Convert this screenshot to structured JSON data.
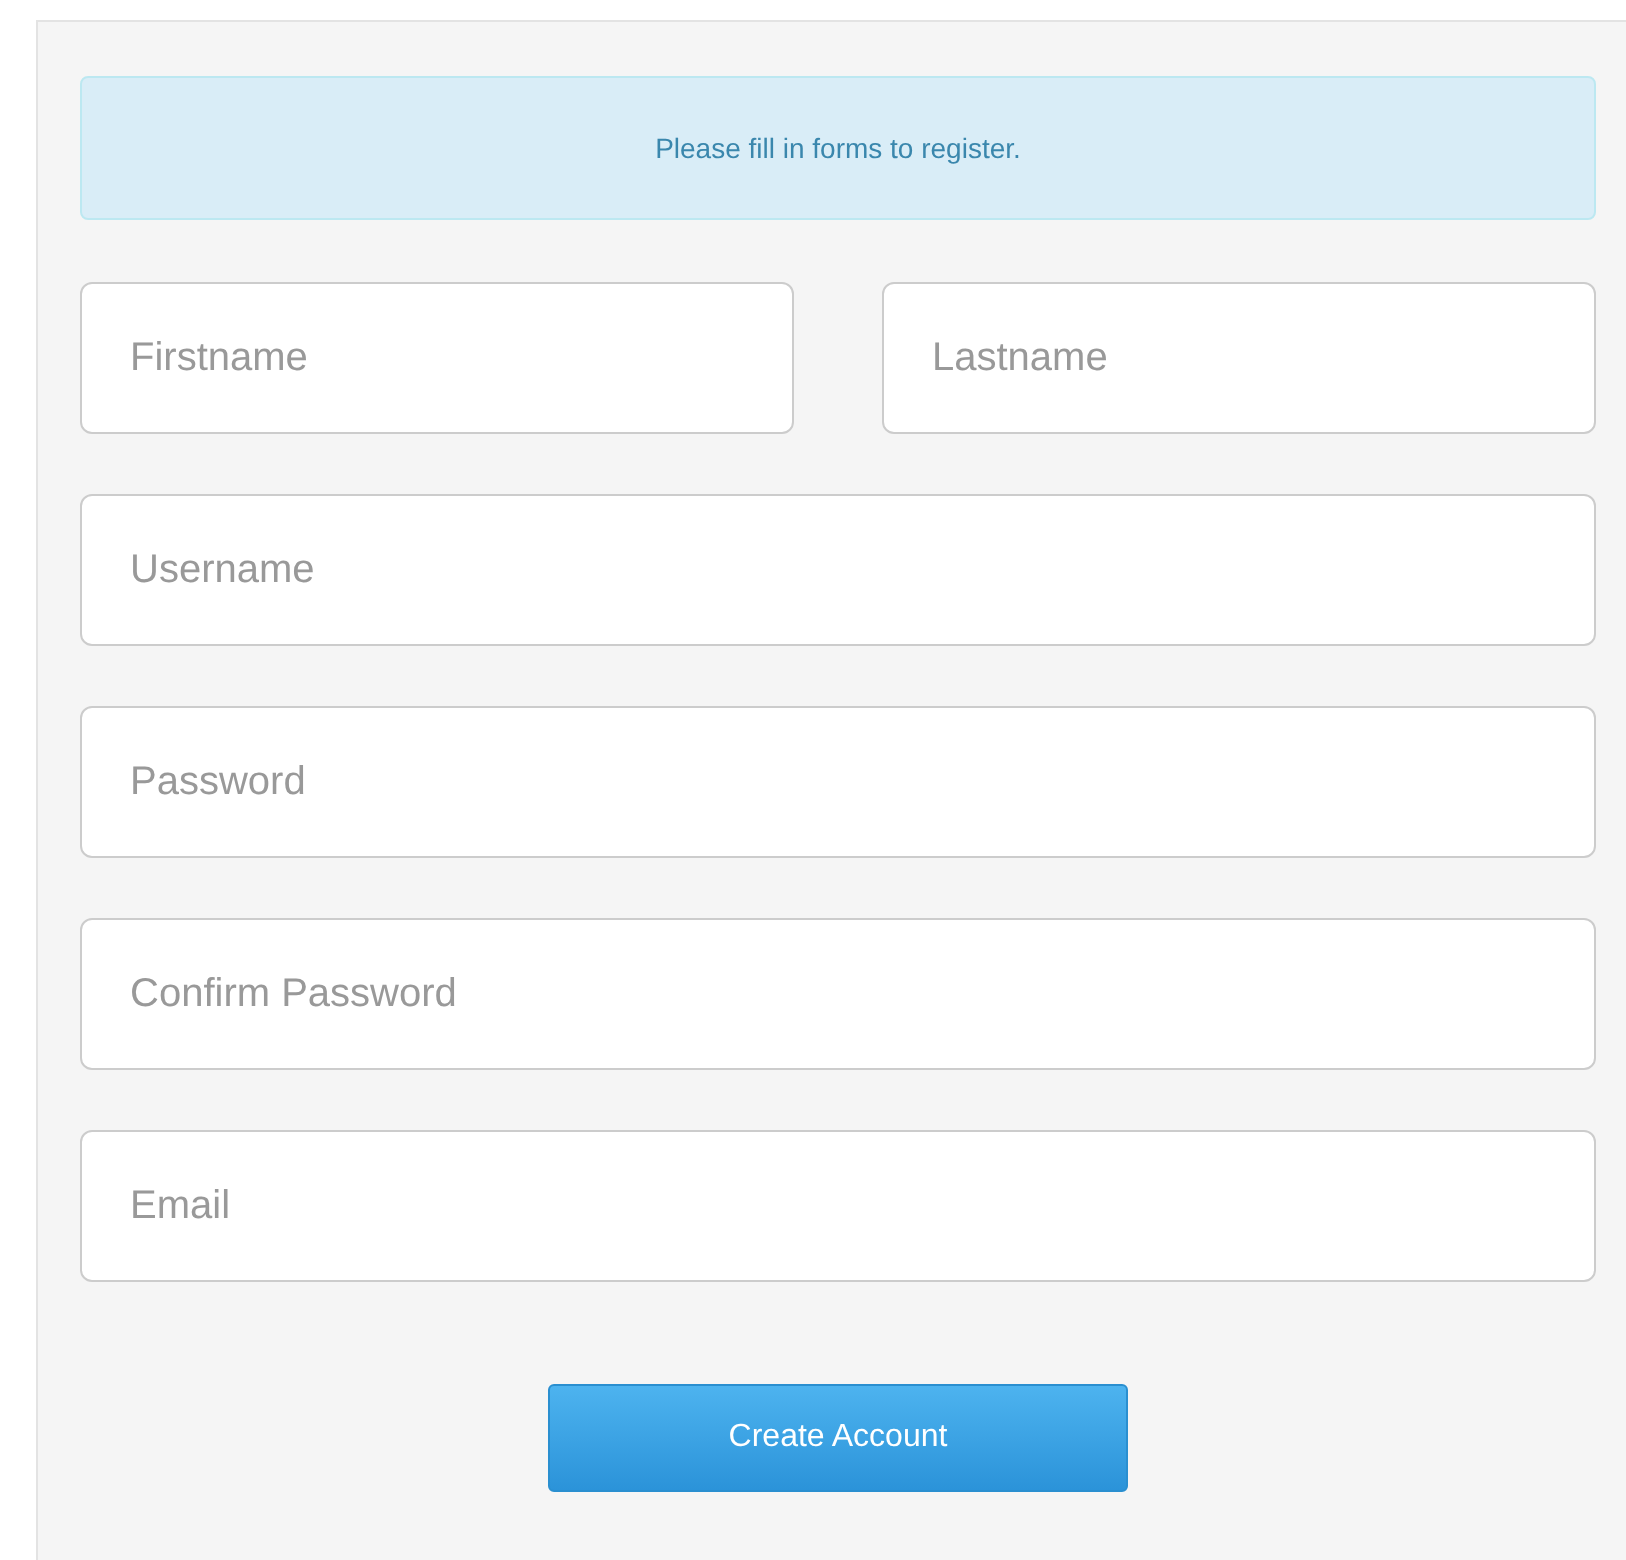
{
  "alert": {
    "text": "Please fill in forms to register."
  },
  "fields": [
    {
      "kind": "half",
      "placeholder": "Firstname"
    },
    {
      "kind": "half",
      "placeholder": "Lastname"
    },
    {
      "kind": "full",
      "placeholder": "Username"
    },
    {
      "kind": "full",
      "placeholder": "Password"
    },
    {
      "kind": "full",
      "placeholder": "Confirm Password"
    },
    {
      "kind": "full",
      "placeholder": "Email"
    }
  ],
  "button": {
    "label": "Create Account"
  }
}
